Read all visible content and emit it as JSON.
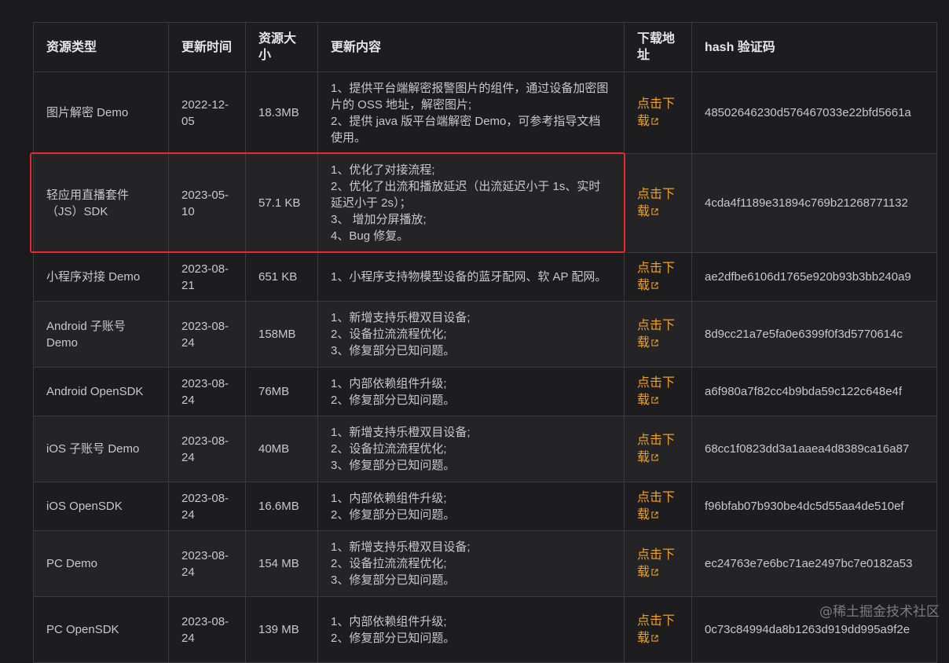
{
  "table": {
    "headers": {
      "type": "资源类型",
      "date": "更新时间",
      "size": "资源大小",
      "content": "更新内容",
      "download": "下载地址",
      "hash": "hash 验证码"
    },
    "download_label": "点击下载",
    "rows": [
      {
        "type": "图片解密 Demo",
        "date": "2022-12-05",
        "size": "18.3MB",
        "content": [
          "1、提供平台端解密报警图片的组件，通过设备加密图片的 OSS 地址，解密图片;",
          "2、提供 java 版平台端解密 Demo，可参考指导文档使用。"
        ],
        "hash": "48502646230d576467033e22bfd5661a"
      },
      {
        "type": "轻应用直播套件（JS）SDK",
        "date": "2023-05-10",
        "size": "57.1 KB",
        "content": [
          "1、优化了对接流程;",
          "2、优化了出流和播放延迟（出流延迟小于 1s、实时延迟小于 2s）；",
          "3、 增加分屏播放;",
          "4、Bug 修复。"
        ],
        "hash": "4cda4f1189e31894c769b21268771132"
      },
      {
        "type": "小程序对接 Demo",
        "date": "2023-08-21",
        "size": "651 KB",
        "content": [
          "1、小程序支持物模型设备的蓝牙配网、软 AP 配网。"
        ],
        "hash": "ae2dfbe6106d1765e920b93b3bb240a9"
      },
      {
        "type": "Android 子账号 Demo",
        "date": "2023-08-24",
        "size": "158MB",
        "content": [
          "1、新增支持乐橙双目设备;",
          "2、设备拉流流程优化;",
          "3、修复部分已知问题。"
        ],
        "hash": "8d9cc21a7e5fa0e6399f0f3d5770614c"
      },
      {
        "type": "Android OpenSDK",
        "date": "2023-08-24",
        "size": "76MB",
        "content": [
          "1、内部依赖组件升级;",
          "2、修复部分已知问题。"
        ],
        "hash": "a6f980a7f82cc4b9bda59c122c648e4f"
      },
      {
        "type": "iOS 子账号 Demo",
        "date": "2023-08-24",
        "size": "40MB",
        "content": [
          "1、新增支持乐橙双目设备;",
          "2、设备拉流流程优化;",
          "3、修复部分已知问题。"
        ],
        "hash": "68cc1f0823dd3a1aaea4d8389ca16a87"
      },
      {
        "type": "iOS OpenSDK",
        "date": "2023-08-24",
        "size": "16.6MB",
        "content": [
          "1、内部依赖组件升级;",
          "2、修复部分已知问题。"
        ],
        "hash": "f96bfab07b930be4dc5d55aa4de510ef"
      },
      {
        "type": "PC Demo",
        "date": "2023-08-24",
        "size": "154 MB",
        "content": [
          "1、新增支持乐橙双目设备;",
          "2、设备拉流流程优化;",
          "3、修复部分已知问题。"
        ],
        "hash": "ec24763e7e6bc71ae2497bc7e0182a53"
      },
      {
        "type": "PC OpenSDK",
        "date": "2023-08-24",
        "size": "139 MB",
        "content": [
          "1、内部依赖组件升级;",
          "2、修复部分已知问题。"
        ],
        "hash": "0c73c84994da8b1263d919dd995a9f2e"
      }
    ]
  },
  "watermark": "@稀土掘金技术社区",
  "colors": {
    "background": "#1b1b1d",
    "link": "#f0a020",
    "highlight": "#e8292e"
  }
}
